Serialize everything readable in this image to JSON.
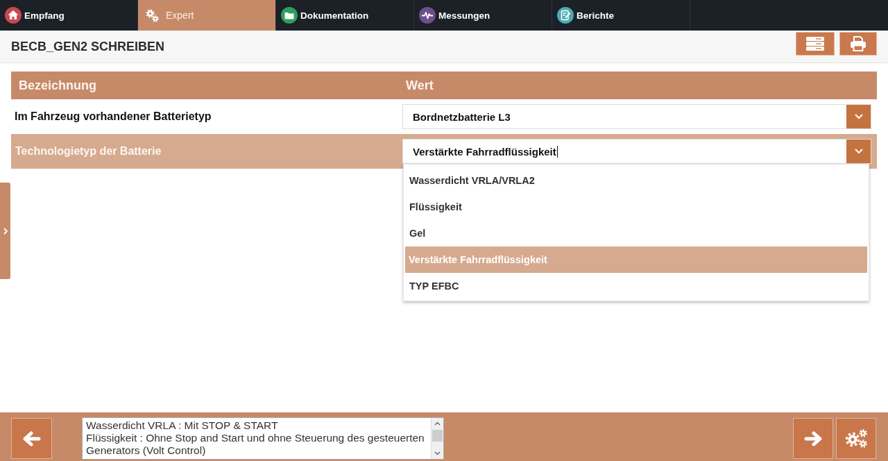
{
  "nav_tabs": [
    {
      "label": "Empfang",
      "selected": false,
      "color": "#c9474f"
    },
    {
      "label": "Expert",
      "selected": true
    },
    {
      "label": "Dokumentation",
      "selected": false,
      "color": "#2f9e5b"
    },
    {
      "label": "Messungen",
      "selected": false,
      "color": "#6d4f8a"
    },
    {
      "label": "Berichte",
      "selected": false,
      "color": "#4ea9b1"
    }
  ],
  "page_title": "BECB_GEN2 SCHREIBEN",
  "table": {
    "columns": [
      "Bezeichnung",
      "Wert"
    ],
    "rows": [
      {
        "label": "Im Fahrzeug vorhandener Batterietyp",
        "value": "Bordnetzbatterie L3",
        "selected": false,
        "expanded": false
      },
      {
        "label": "Technologietyp der Batterie",
        "value": "Verstärkte Fahrradflüssigkeit",
        "selected": true,
        "expanded": true,
        "options": [
          {
            "label": "Wasserdicht VRLA/VRLA2",
            "selected": false
          },
          {
            "label": "Flüssigkeit",
            "selected": false
          },
          {
            "label": "Gel",
            "selected": false
          },
          {
            "label": "Verstärkte Fahrradflüssigkeit",
            "selected": true
          },
          {
            "label": "TYP EFBC",
            "selected": false
          }
        ]
      }
    ]
  },
  "description": [
    "Wasserdicht VRLA : Mit STOP & START",
    "Flüssigkeit : Ohne Stop and Start und ohne Steuerung des gesteuerten Generators (Volt Control)"
  ]
}
